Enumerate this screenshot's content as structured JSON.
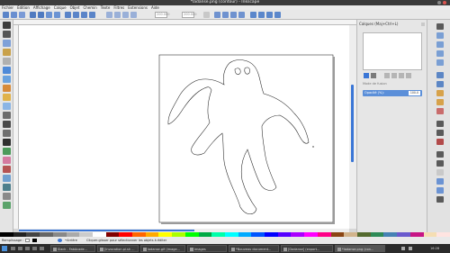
{
  "window": {
    "title": "*ladanse.png (contour) - Inkscape"
  },
  "menu": [
    "Fichier",
    "Édition",
    "Affichage",
    "Calque",
    "Objet",
    "Chemin",
    "Texte",
    "Filtres",
    "Extensions",
    "Aide"
  ],
  "command_bar": {
    "x_value": "200.000",
    "y_value": "200.000"
  },
  "dock": {
    "title": "Calques (Maj+Ctrl+L)",
    "mode_label": "Mode de fusion",
    "opacity_label": "Opacité (%):",
    "opacity_value": "100.0"
  },
  "status": {
    "zoom_label": "Remplissage :",
    "layer": "•Arrière",
    "message": "Cliquer-glisser pour sélectionner les objets à éditer"
  },
  "taskbar": {
    "items": [
      "Slack - FabAcade...",
      "[Invocation.pi.sh ...",
      "ladanse.gif (image...",
      "images",
      "*Nouveau document...",
      "[Dadanse] (export...",
      "*ladanse.png (con..."
    ],
    "clock": "16:28"
  },
  "colors": {
    "accent": "#3a76d6",
    "canvas": "#ffffff",
    "toolbar": "#e8e8e8"
  }
}
